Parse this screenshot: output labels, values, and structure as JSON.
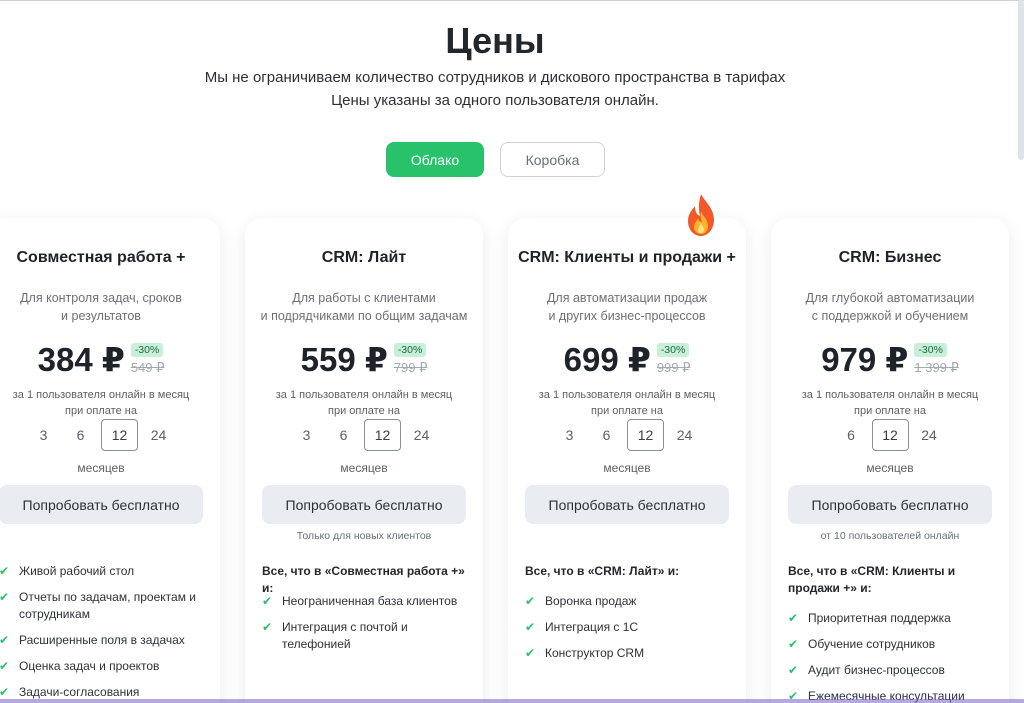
{
  "header": {
    "title": "Цены",
    "subtitle_line1": "Мы не ограничиваем количество сотрудников и дискового пространства в тарифах",
    "subtitle_line2": "Цены указаны за одного пользователя онлайн."
  },
  "toggle": {
    "active_label": "Облако",
    "inactive_label": "Коробка",
    "accent_color": "#27c26a"
  },
  "period_text_line1": "за 1 пользователя онлайн в месяц",
  "period_text_line2": "при оплате на",
  "months_label": "месяцев",
  "try_button_label": "Попробовать бесплатно",
  "plans": [
    {
      "title": "Совместная работа +",
      "desc_line1": "Для контроля задач, сроков",
      "desc_line2": "и результатов",
      "price": "384 ₽",
      "discount": "-30%",
      "old_price": "549 ₽",
      "months": [
        "3",
        "6",
        "12",
        "24"
      ],
      "selected_month": "12",
      "try_note": "",
      "includes": "",
      "features": [
        "Живой рабочий стол",
        "Отчеты по задачам, проектам и сотрудникам",
        "Расширенные поля в задачах",
        "Оценка задач и проектов",
        "Задачи-согласования"
      ]
    },
    {
      "title": "CRM: Лайт",
      "desc_line1": "Для работы с клиентами",
      "desc_line2": "и подрядчиками по общим задачам",
      "price": "559 ₽",
      "discount": "-30%",
      "old_price": "799 ₽",
      "months": [
        "3",
        "6",
        "12",
        "24"
      ],
      "selected_month": "12",
      "try_note": "Только для новых клиентов",
      "includes": "Все, что в «Совместная работа +» и:",
      "features": [
        "Неограниченная база клиентов",
        "Интеграция с почтой и телефонией"
      ]
    },
    {
      "title": "CRM: Клиенты и продажи +",
      "desc_line1": "Для автоматизации продаж",
      "desc_line2": "и других бизнес-процессов",
      "price": "699 ₽",
      "discount": "-30%",
      "old_price": "999 ₽",
      "months": [
        "3",
        "6",
        "12",
        "24"
      ],
      "selected_month": "12",
      "try_note": "",
      "includes": "Все, что в «CRM: Лайт» и:",
      "features": [
        "Воронка продаж",
        "Интеграция с 1С",
        "Конструктор CRM"
      ],
      "badge_icon": "fire-icon"
    },
    {
      "title": "CRM: Бизнес",
      "desc_line1": "Для глубокой автоматизации",
      "desc_line2": "с поддержкой и обучением",
      "price": "979 ₽",
      "discount": "-30%",
      "old_price": "1 399 ₽",
      "months": [
        "6",
        "12",
        "24"
      ],
      "selected_month": "12",
      "try_note": "от 10 пользователей онлайн",
      "includes": "Все, что в «CRM: Клиенты и продажи +» и:",
      "features": [
        "Приоритетная поддержка",
        "Обучение сотрудников",
        "Аудит бизнес-процессов",
        "Ежемесячные консультации"
      ]
    }
  ]
}
